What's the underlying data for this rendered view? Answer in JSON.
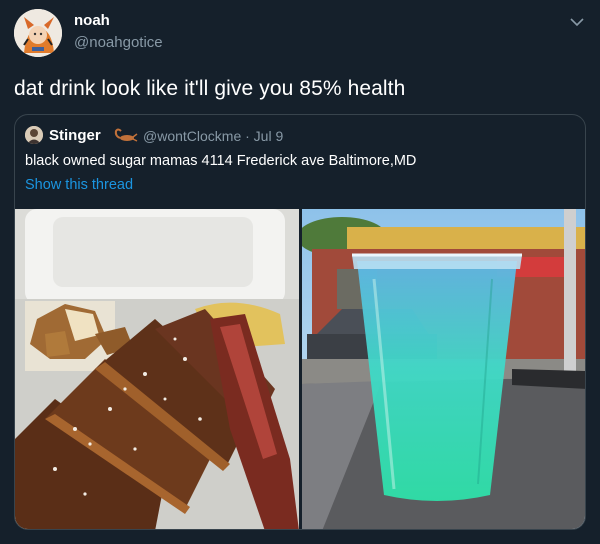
{
  "tweet": {
    "author_name": "noah",
    "author_handle": "@noahgotice",
    "text": "dat drink look like it'll give you 85% health"
  },
  "quoted": {
    "author_name": "Stinger",
    "meta": "@wontClockme · Jul 9",
    "text": "black owned sugar mamas 4114 Frederick ave Baltimore,MD",
    "thread_link": "Show this thread"
  },
  "icons": {
    "menu": "chevron-down-icon",
    "author_emoji": "scorpion-emoji"
  },
  "colors": {
    "background": "#15202b",
    "secondary_text": "#8899a6",
    "link": "#1b95e0",
    "border": "#38444d"
  }
}
